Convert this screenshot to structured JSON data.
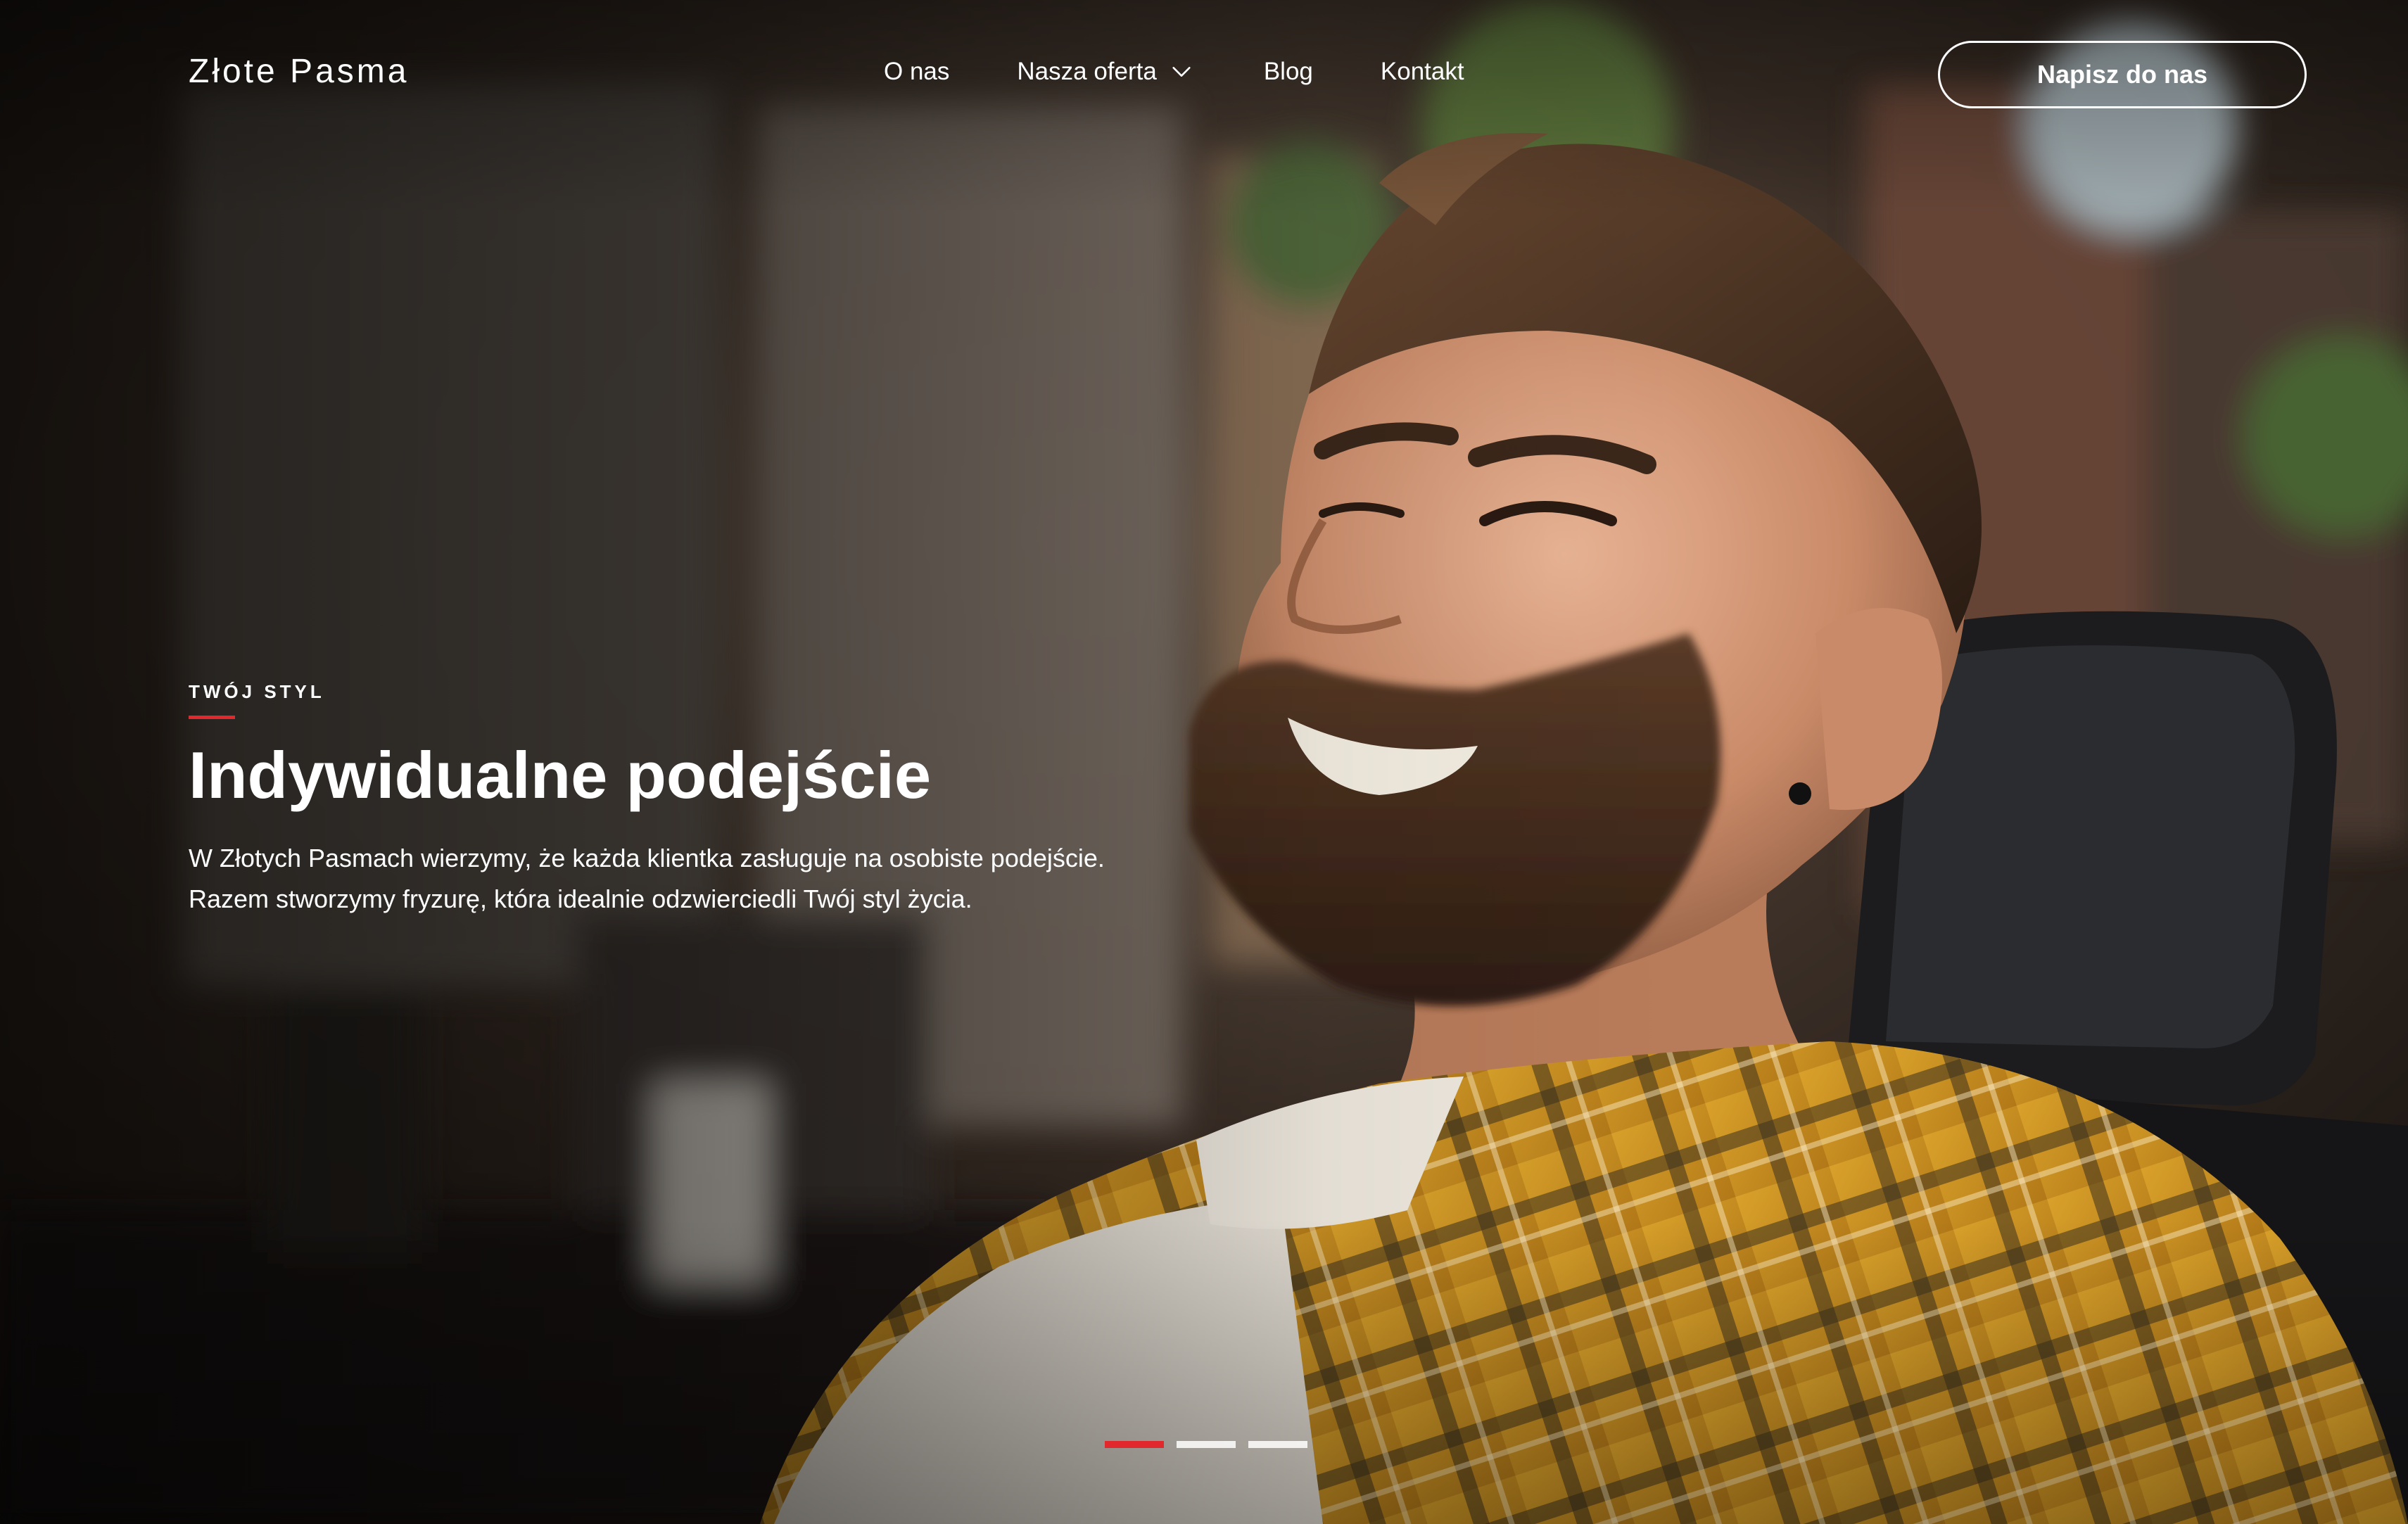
{
  "brand": {
    "name": "Złote Pasma"
  },
  "nav": {
    "items": [
      {
        "label": "O nas"
      },
      {
        "label": "Nasza oferta",
        "has_dropdown": true
      },
      {
        "label": "Blog"
      },
      {
        "label": "Kontakt"
      }
    ],
    "cta_label": "Napisz do nas"
  },
  "hero": {
    "eyebrow": "TWÓJ STYL",
    "title": "Indywidualne podejście",
    "description_line1": "W Złotych Pasmach wierzymy, że każda klientka zasługuje na osobiste podejście.",
    "description_line2": "Razem stworzymy fryzurę, która idealnie odzwierciedli Twój styl życia.",
    "slides_total": 3,
    "active_slide": 1
  },
  "colors": {
    "accent": "#e0282d",
    "text": "#ffffff"
  },
  "icons": {
    "dropdown": "chevron-down-icon"
  }
}
